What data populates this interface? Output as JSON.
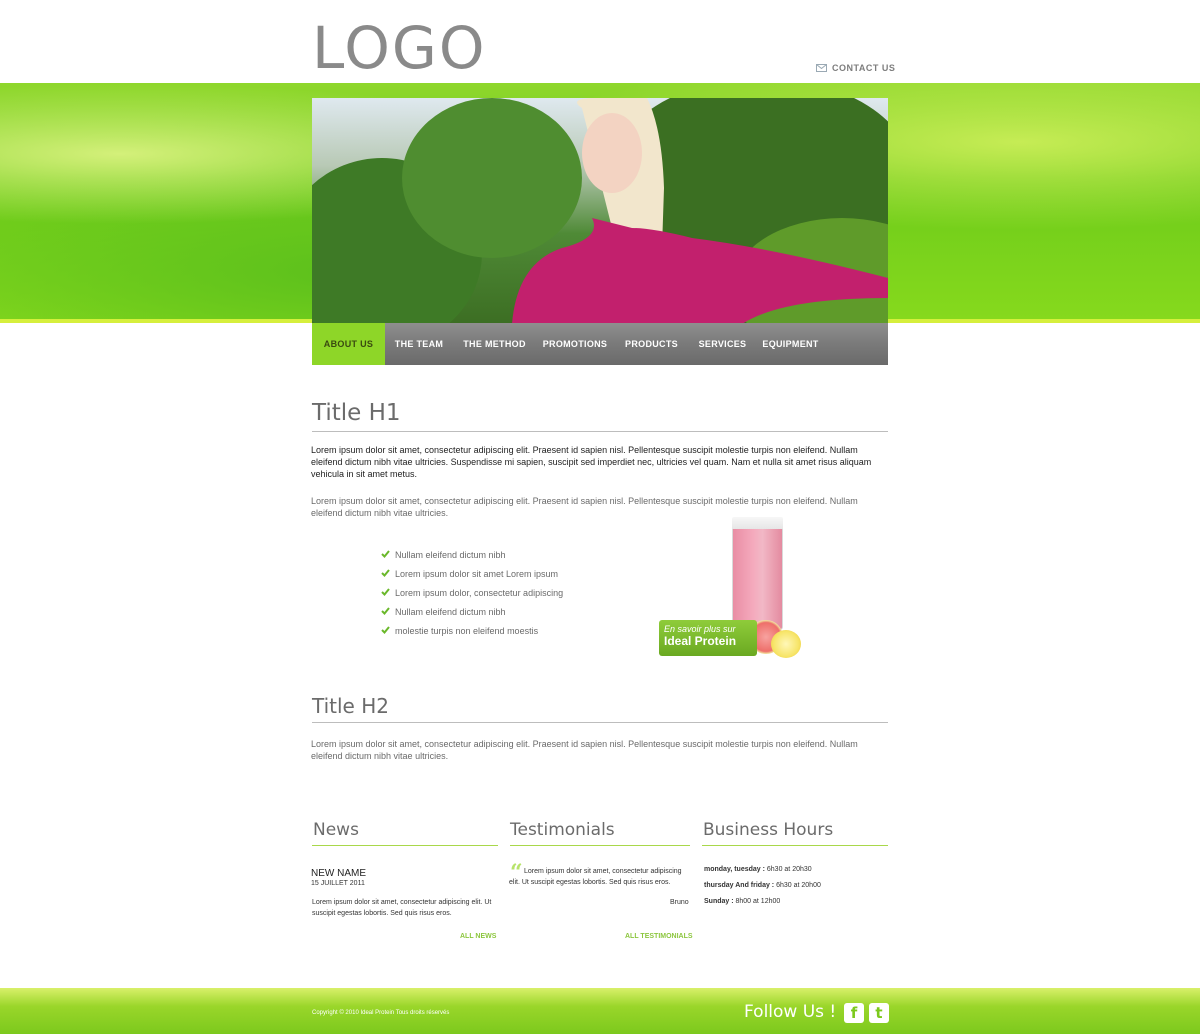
{
  "header": {
    "logo": "LOGO",
    "contact_label": "CONTACT US"
  },
  "nav": [
    {
      "label": "ABOUT US",
      "active": true
    },
    {
      "label": "THE TEAM"
    },
    {
      "label": "THE METHOD"
    },
    {
      "label": "PROMOTIONS"
    },
    {
      "label": "PRODUCTS"
    },
    {
      "label": "SERVICES"
    },
    {
      "label": "EQUIPMENT"
    }
  ],
  "content": {
    "h1": "Title H1",
    "p1": "Lorem ipsum dolor sit amet, consectetur adipiscing elit. Praesent id sapien nisl. Pellentesque suscipit molestie turpis non eleifend. Nullam eleifend dictum nibh vitae ultricies. Suspendisse mi sapien, suscipit sed imperdiet nec, ultricies vel quam. Nam et nulla sit amet risus aliquam vehicula in sit amet metus.",
    "p2": "Lorem ipsum dolor sit amet, consectetur adipiscing elit. Praesent id sapien nisl. Pellentesque suscipit molestie turpis non eleifend. Nullam eleifend dictum nibh vitae ultricies.",
    "checklist": [
      "Nullam eleifend dictum nibh",
      "Lorem ipsum dolor sit amet Lorem ipsum",
      "Lorem ipsum dolor, consectetur adipiscing",
      "Nullam eleifend dictum nibh",
      "molestie turpis non eleifend moestis"
    ],
    "promo_line1": "En savoir plus sur",
    "promo_line2": "Ideal Protein",
    "h2": "Title H2",
    "p3": "Lorem ipsum dolor sit amet, consectetur adipiscing elit. Praesent id sapien nisl. Pellentesque suscipit molestie turpis non eleifend. Nullam eleifend dictum nibh vitae ultricies."
  },
  "news": {
    "title": "News",
    "name": "NEW NAME",
    "date": "15 JUILLET 2011",
    "text": "Lorem ipsum dolor sit amet, consectetur adipiscing elit. Ut suscipit egestas lobortis. Sed quis risus eros.",
    "more": "ALL NEWS"
  },
  "testimonials": {
    "title": "Testimonials",
    "text": "Lorem ipsum dolor sit amet, consectetur adipiscing elit. Ut suscipit egestas lobortis. Sed quis risus eros.",
    "author": "Bruno",
    "more": "ALL TESTIMONIALS"
  },
  "hours": {
    "title": "Business Hours",
    "rows": [
      {
        "days": "monday, tuesday :",
        "time": " 6h30 at 20h30"
      },
      {
        "days": "thursday And friday :",
        "time": " 6h30 at 20h00"
      },
      {
        "days": "Sunday :",
        "time": " 8h00 at 12h00"
      }
    ]
  },
  "footer": {
    "copyright": "Copyright © 2010 Ideal Protein Tous droits réservés",
    "follow": "Follow Us !",
    "facebook": "f",
    "twitter": "t"
  },
  "colors": {
    "accent_green": "#8ed628",
    "nav_grey": "#7a7a7a",
    "link_green": "#8cc63e"
  }
}
